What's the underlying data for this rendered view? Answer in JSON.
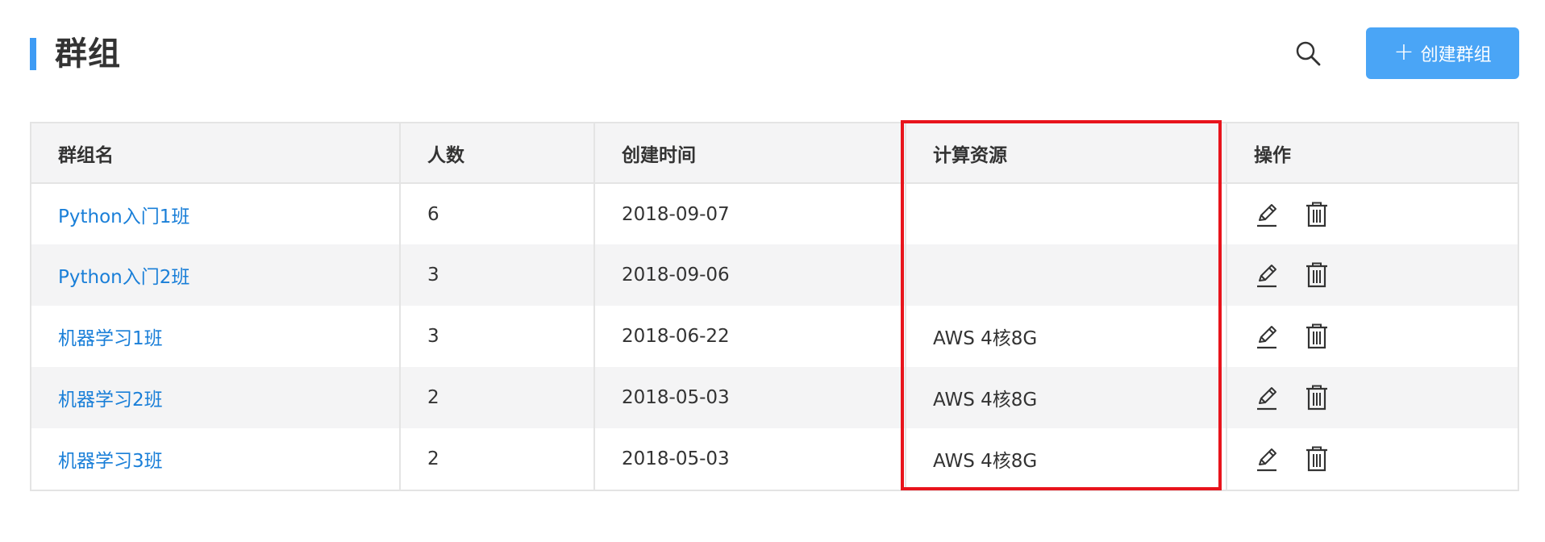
{
  "header": {
    "title": "群组",
    "create_button_label": "创建群组",
    "accent_color": "#3e9bf4",
    "button_color": "#4aa5f6"
  },
  "table": {
    "columns": [
      "群组名",
      "人数",
      "创建时间",
      "计算资源",
      "操作"
    ],
    "rows": [
      {
        "name": "Python入门1班",
        "members": "6",
        "created": "2018-09-07",
        "resource": ""
      },
      {
        "name": "Python入门2班",
        "members": "3",
        "created": "2018-09-06",
        "resource": ""
      },
      {
        "name": "机器学习1班",
        "members": "3",
        "created": "2018-06-22",
        "resource": "AWS 4核8G"
      },
      {
        "name": "机器学习2班",
        "members": "2",
        "created": "2018-05-03",
        "resource": "AWS 4核8G"
      },
      {
        "name": "机器学习3班",
        "members": "2",
        "created": "2018-05-03",
        "resource": "AWS 4核8G"
      }
    ]
  },
  "icons": {
    "search": "search-icon",
    "plus": "plus-icon",
    "edit": "pencil-icon",
    "delete": "trash-icon"
  },
  "annotation": {
    "highlight_color": "#e8141c",
    "highlighted_column": "计算资源"
  }
}
